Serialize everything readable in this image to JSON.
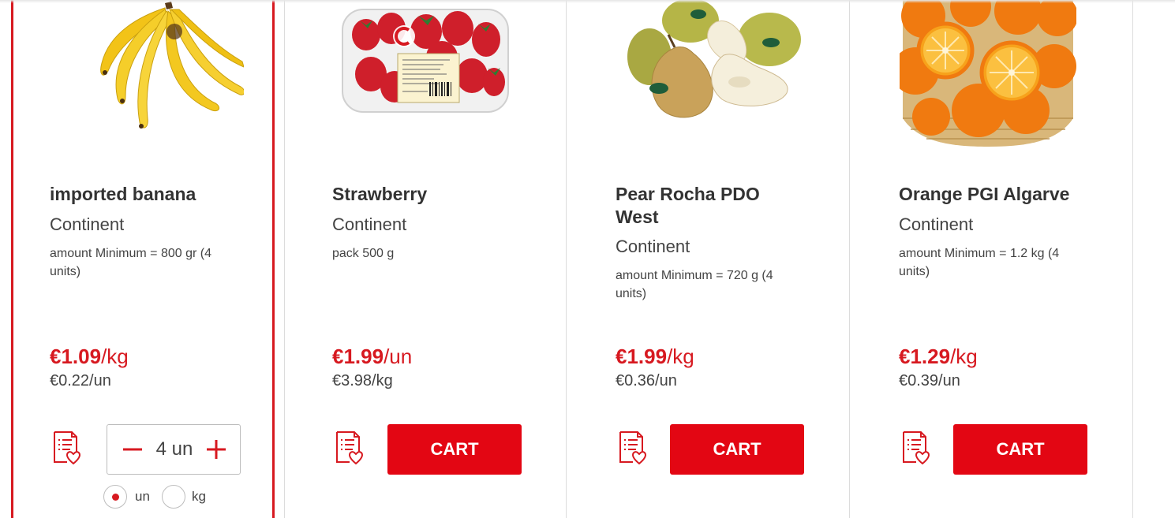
{
  "products": [
    {
      "name": "imported banana",
      "brand": "Continent",
      "quantity": "amount Minimum = 800 gr (4 units)",
      "price": "€1.09",
      "price_unit": "/kg",
      "unit_price": "€0.22/un",
      "image": "banana-image"
    },
    {
      "name": "Strawberry",
      "brand": "Continent",
      "quantity": "pack 500 g",
      "price": "€1.99",
      "price_unit": "/un",
      "unit_price": "€3.98/kg",
      "cart_label": "CART",
      "image": "strawberry-pack-image"
    },
    {
      "name": "Pear Rocha PDO West",
      "brand": "Continent",
      "quantity": "amount Minimum = 720 g (4 units)",
      "price": "€1.99",
      "price_unit": "/kg",
      "unit_price": "€0.36/un",
      "cart_label": "CART",
      "image": "pear-image"
    },
    {
      "name": "Orange PGI Algarve",
      "brand": "Continent",
      "quantity": "amount Minimum = 1.2 kg (4 units)",
      "price": "€1.29",
      "price_unit": "/kg",
      "unit_price": "€0.39/un",
      "cart_label": "CART",
      "image": "orange-basket-image"
    }
  ],
  "stepper": {
    "value": "4 un",
    "minus_icon": "minus-icon",
    "plus_icon": "plus-icon"
  },
  "unit_options": [
    {
      "label": "un",
      "selected": true
    },
    {
      "label": "kg",
      "selected": false
    }
  ],
  "icons": {
    "list": "shopping-list-heart-icon"
  },
  "colors": {
    "accent": "#e30613",
    "price": "#d71920",
    "border": "#dcdcdc"
  }
}
